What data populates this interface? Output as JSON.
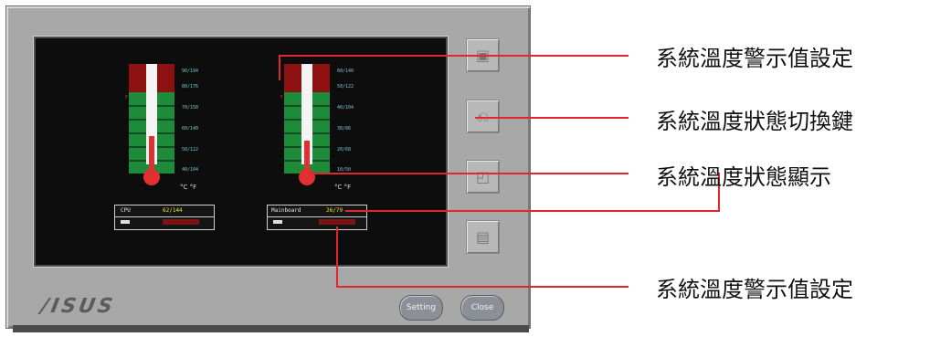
{
  "brand": {
    "logo_text": "/ISUS"
  },
  "buttons": {
    "setting": "Setting",
    "close": "Close"
  },
  "side_buttons": [
    {
      "icon": "floppy-icon"
    },
    {
      "icon": "switch-icon"
    },
    {
      "icon": "display-icon"
    },
    {
      "icon": "document-icon"
    }
  ],
  "cpu": {
    "label": "CPU",
    "value": "62/144",
    "scale": [
      "90/194",
      "80/176",
      "70/158",
      "60/140",
      "50/122",
      "40/104"
    ],
    "units": "°C °F"
  },
  "mainboard": {
    "label": "Mainboard",
    "value": "26/79",
    "scale": [
      "60/140",
      "50/122",
      "40/104",
      "30/86",
      "20/68",
      "10/50"
    ],
    "units": "°C °F"
  },
  "annotations": [
    "系統溫度警示值設定",
    "系統溫度狀態切換鍵",
    "系統溫度狀態顯示",
    "系統溫度警示值設定"
  ],
  "colors": {
    "annotation_line": "#e3262d",
    "bar_green": "#1d8b3a",
    "bar_red": "#8e1111",
    "accent_yellow": "#f1e51b"
  }
}
